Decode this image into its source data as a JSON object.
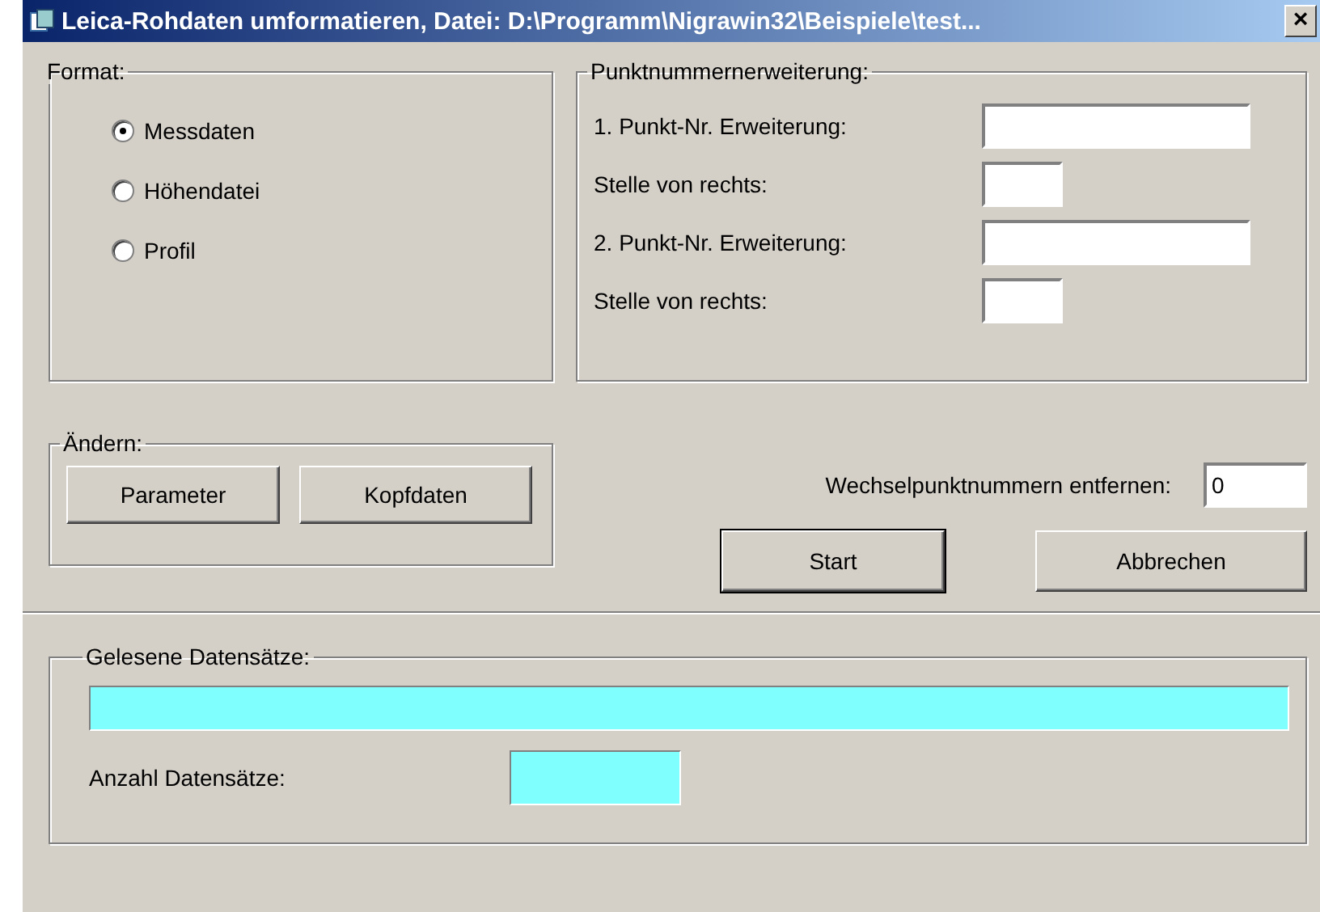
{
  "window": {
    "title": "Leica-Rohdaten umformatieren, Datei: D:\\Programm\\Nigrawin32\\Beispiele\\test...",
    "close": "×"
  },
  "format": {
    "legend": "Format:",
    "options": [
      {
        "label": "Messdaten",
        "selected": true
      },
      {
        "label": "Höhendatei",
        "selected": false
      },
      {
        "label": "Profil",
        "selected": false
      }
    ]
  },
  "extension": {
    "legend": "Punktnummernerweiterung:",
    "fields": [
      {
        "label": "1. Punkt-Nr. Erweiterung:",
        "kind": "wide"
      },
      {
        "label": "Stelle von rechts:",
        "kind": "short"
      },
      {
        "label": "2. Punkt-Nr. Erweiterung:",
        "kind": "wide"
      },
      {
        "label": "Stelle von rechts:",
        "kind": "short"
      }
    ]
  },
  "change": {
    "legend": "Ändern:",
    "buttons": [
      "Parameter",
      "Kopfdaten"
    ]
  },
  "remove": {
    "label": "Wechselpunktnummern entfernen:",
    "value": "0"
  },
  "actions": [
    {
      "label": "Start",
      "default": true
    },
    {
      "label": "Abbrechen",
      "default": false
    }
  ],
  "progress": {
    "legend": "Gelesene Datensätze:",
    "level": 1,
    "count_label": "Anzahl Datensätze:"
  }
}
